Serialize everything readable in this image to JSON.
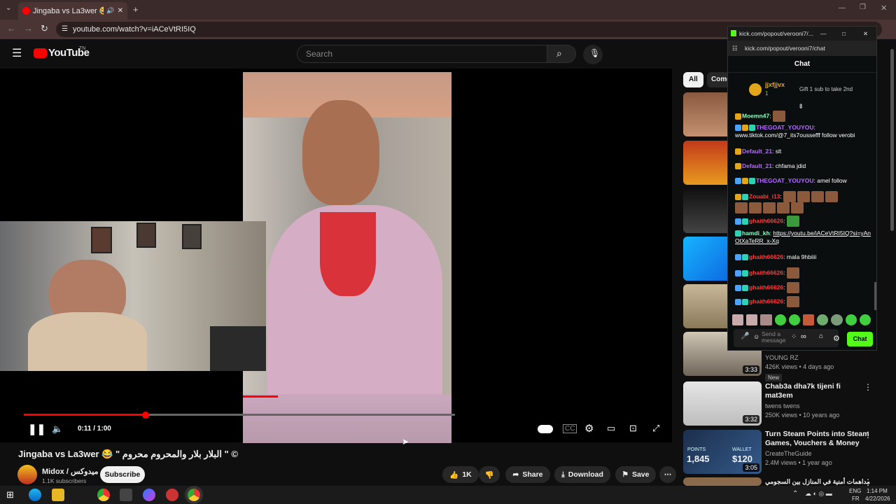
{
  "browser": {
    "tab_title": "Jingaba vs La3wer 😂 \" البلا",
    "url": "youtube.com/watch?v=iACeVtRI5IQ"
  },
  "youtube": {
    "logo": "YouTube",
    "logo_region": "TN",
    "search_placeholder": "Search"
  },
  "player": {
    "current_time": "0:11 / 1:00",
    "progress_fraction": 0.183
  },
  "video": {
    "title": "Jingaba vs La3wer 😂 \" البلار بلار والمحروم محروم \" ©",
    "channel": "Midox / ميدوكس",
    "subscribers": "1.1K subscribers",
    "subscribe_label": "Subscribe",
    "likes": "1K",
    "share_label": "Share",
    "download_label": "Download",
    "save_label": "Save"
  },
  "sidebar": {
    "chips": [
      "All",
      "Come"
    ],
    "items": [
      {
        "title": "",
        "meta": "YOUNG RZ",
        "stats": "426K views • 4 days ago",
        "badge": "New",
        "duration": "3:33"
      },
      {
        "title": "Chab3a dha7k tijeni fi mat3em",
        "meta": "twens twens",
        "stats": "250K views • 10 years ago",
        "duration": "3:32"
      },
      {
        "title": "Turn Steam Points into Steam Games, Vouchers & Money",
        "meta": "CreateTheGuide",
        "stats": "2.4M views • 1 year ago",
        "duration": "3:05",
        "thumb_points": "1,845",
        "thumb_wallet": "$120",
        "thumb_label_points": "POINTS",
        "thumb_label_wallet": "WALLET"
      },
      {
        "title": "مداهمات أمنية في المنازل بين السجومي"
      }
    ]
  },
  "kick": {
    "window_title": "kick.com/popout/verooni7/...",
    "url": "kick.com/popout/verooni7/chat",
    "chat_header": "Chat",
    "top_user": "jjxfjjvx",
    "top_user_count": "1",
    "gift_text": "Gift 1 sub to take 2nd",
    "messages": [
      {
        "user": "Moemn47",
        "text": ""
      },
      {
        "user": "THEGOAT_YOUYOU",
        "text": "www.tiktok.com/@7_its7oussefff follow verobi"
      },
      {
        "user": "Default_21",
        "text": "slt"
      },
      {
        "user": "Default_21",
        "text": "chfama jdid"
      },
      {
        "user": "THEGOAT_YOUYOU",
        "text": "amel follow"
      },
      {
        "user": "Zouabi_i13",
        "text": ""
      },
      {
        "user": "ghaith66626",
        "text": ""
      },
      {
        "user": "hamdi_kh",
        "text": "https://youtu.be/iACeVtRI5IQ?si=yAnOtXaTeRR_x-Xq"
      },
      {
        "user": "ghaith66626",
        "text": "mala 9hbiiii"
      },
      {
        "user": "ghaith66626",
        "text": ""
      },
      {
        "user": "ghaith66626",
        "text": ""
      },
      {
        "user": "ghaith66626",
        "text": ""
      }
    ],
    "input_placeholder": "Send a message",
    "chat_button": "Chat",
    "colors": {
      "accent": "#53fc18",
      "user_purple": "#b36bff",
      "user_red": "#ff3b3b",
      "user_green": "#8affc1"
    }
  },
  "taskbar": {
    "lang": "ENG",
    "region": "FR",
    "time": "1:14 PM",
    "date": "4/22/2026"
  }
}
